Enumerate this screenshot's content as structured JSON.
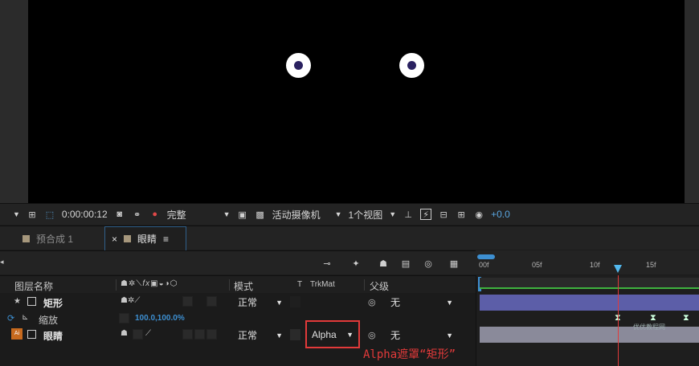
{
  "viewer": {
    "toolbar": {
      "timecode": "0:00:00:12",
      "resolution": "完整",
      "camera": "活动摄像机",
      "views": "1个视图",
      "exposure": "+0.0"
    }
  },
  "tabs": [
    {
      "label": "预合成 1",
      "active": false
    },
    {
      "label": "眼睛",
      "active": true
    }
  ],
  "tab_close": "×",
  "tab_menu": "≡",
  "timeline": {
    "ruler_ticks": [
      "00f",
      "05f",
      "10f",
      "15f"
    ],
    "columns": {
      "layer_name": "图层名称",
      "mode": "模式",
      "t": "T",
      "trkmat": "TrkMat",
      "parent": "父级"
    },
    "layers": [
      {
        "name": "矩形",
        "mode": "正常",
        "trkmat": "",
        "parent": "无"
      },
      {
        "property": "缩放",
        "value": "100.0,100.0%"
      },
      {
        "name": "眼睛",
        "mode": "正常",
        "trkmat": "Alpha",
        "parent": "无"
      }
    ]
  },
  "annotation": "Alpha遮罩“矩形”",
  "watermark": "优优教程网",
  "colors": {
    "accent": "#2f8fd0",
    "annotation": "#e23a3a",
    "track_bar": "#5c5ea8",
    "track_bar2": "#8a8a9a"
  }
}
